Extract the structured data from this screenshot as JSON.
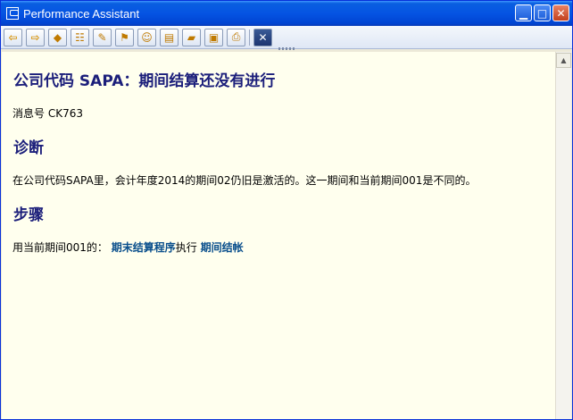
{
  "window": {
    "title": "Performance Assistant",
    "controls": {
      "minimize": "▁",
      "maximize": "□",
      "close": "✕"
    }
  },
  "toolbar": {
    "buttons": [
      "back-icon",
      "forward-icon",
      "book-icon",
      "structure-icon",
      "edit-icon",
      "flag-icon",
      "users-icon",
      "document-icon",
      "ticket-icon",
      "collapse-icon",
      "print-icon",
      "close-x-icon"
    ]
  },
  "content": {
    "title": "公司代码  SAPA：期间结算还没有进行",
    "message_number": "消息号  CK763",
    "diagnosis_heading": "诊断",
    "diagnosis_text": "在公司代码SAPA里，会计年度2014的期间02仍旧是激活的。这一期间和当前期间001是不同的。",
    "procedure_heading": "步骤",
    "procedure_prefix": "用当前期间001的：",
    "procedure_link_1": "期末结算程序",
    "procedure_middle": "执行",
    "procedure_link_2": "期间结帐"
  }
}
